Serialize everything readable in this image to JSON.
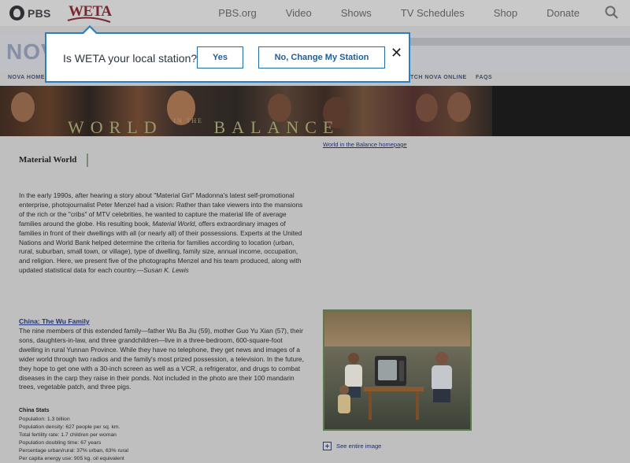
{
  "pbs_nav": {
    "logo_text": "PBS",
    "station_logo_text": "WETA",
    "links": [
      "PBS.org",
      "Video",
      "Shows",
      "TV Schedules",
      "Shop",
      "Donate"
    ],
    "search_icon": "search-icon"
  },
  "nova": {
    "logo_text": "NOV",
    "subnav": {
      "home": "NOVA HOME",
      "watch": "TCH NOVA ONLINE",
      "faqs": "FAQS"
    }
  },
  "banner": {
    "title_left": "WORLD",
    "title_small": "IN THE",
    "title_right": "BALANCE",
    "homepage_link": "World in the Balance homepage"
  },
  "article": {
    "heading": "Material World",
    "intro_part1": "In the early 1990s, after hearing a story about \"Material Girl\" Madonna's latest self-promotional enterprise, photojournalist Peter Menzel had a vision: Rather than take viewers into the mansions of the rich or the \"cribs\" of MTV celebrities, he wanted to capture the material life of average families around the globe. His resulting book, ",
    "intro_book": "Material World",
    "intro_part2": ", offers extraordinary images of families in front of their dwellings with all (or nearly all) of their possessions. Experts at the United Nations and World Bank helped determine the criteria for families according to location (urban, rural, suburban, small town, or village), type of dwelling, family size, annual income, occupation, and religion. Here, we present five of the photographs Menzel and his team produced, along with updated statistical data for each country.—",
    "intro_author": "Susan K. Lewis",
    "section_title": "China: The Wu Family",
    "section_body": "The nine members of this extended family—father Wu Ba Jiu (59), mother Guo Yu Xian (57), their sons, daughters-in-law, and three grandchildren—live in a three-bedroom, 600-square-foot dwelling in rural Yunnan Province. While they have no telephone, they get news and images of a wider world through two radios and the family's most prized possession, a television. In the future, they hope to get one with a 30-inch screen as well as a VCR, a refrigerator, and drugs to combat diseases in the carp they raise in their ponds. Not included in the photo are their 100 mandarin trees, vegetable patch, and three pigs.",
    "stats_title": "China Stats",
    "stats": [
      "Population: 1.3 billion",
      "Population density: 627 people per sq. km.",
      "Total fertility rate: 1.7 children per woman",
      "Population doubling time: 67 years",
      "Percentage urban/rural: 37% urban, 63% rural",
      "Per capita energy use: 905 kg. oil equivalent"
    ],
    "see_image_label": "See entire image"
  },
  "modal": {
    "question": "Is WETA your local station?",
    "yes_label": "Yes",
    "change_label": "No, Change My Station",
    "close_label": "✕",
    "accent_color": "#2a7fc0"
  }
}
